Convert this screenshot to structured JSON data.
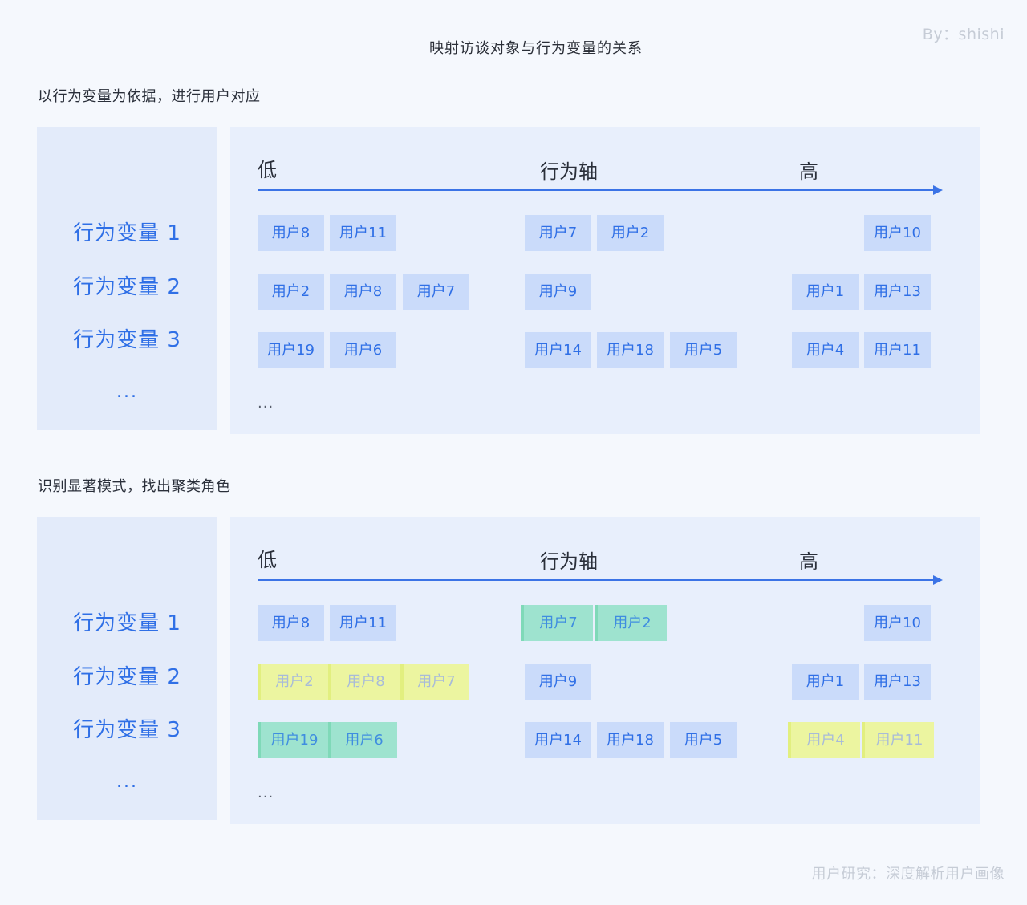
{
  "title": "映射访谈对象与行为变量的关系",
  "byline": "By：shishi",
  "footer": "用户研究：深度解析用户画像",
  "sections": [
    {
      "heading": "以行为变量为依据，进行用户对应",
      "variables": [
        "行为变量 1",
        "行为变量 2",
        "行为变量 3"
      ],
      "variables_more": "...",
      "axis": {
        "low": "低",
        "label": "行为轴",
        "high": "高"
      },
      "more": "...",
      "rows": [
        [
          {
            "label": "用户8",
            "highlight": "none"
          },
          {
            "label": "用户11",
            "highlight": "none"
          },
          {
            "label": "用户7",
            "highlight": "none"
          },
          {
            "label": "用户2",
            "highlight": "none"
          },
          {
            "label": "用户10",
            "highlight": "none"
          }
        ],
        [
          {
            "label": "用户2",
            "highlight": "none"
          },
          {
            "label": "用户8",
            "highlight": "none"
          },
          {
            "label": "用户7",
            "highlight": "none"
          },
          {
            "label": "用户9",
            "highlight": "none"
          },
          {
            "label": "用户1",
            "highlight": "none"
          },
          {
            "label": "用户13",
            "highlight": "none"
          }
        ],
        [
          {
            "label": "用户19",
            "highlight": "none"
          },
          {
            "label": "用户6",
            "highlight": "none"
          },
          {
            "label": "用户14",
            "highlight": "none"
          },
          {
            "label": "用户18",
            "highlight": "none"
          },
          {
            "label": "用户5",
            "highlight": "none"
          },
          {
            "label": "用户4",
            "highlight": "none"
          },
          {
            "label": "用户11",
            "highlight": "none"
          }
        ]
      ]
    },
    {
      "heading": "识别显著模式，找出聚类角色",
      "variables": [
        "行为变量 1",
        "行为变量 2",
        "行为变量 3"
      ],
      "variables_more": "...",
      "axis": {
        "low": "低",
        "label": "行为轴",
        "high": "高"
      },
      "more": "...",
      "rows": [
        [
          {
            "label": "用户8",
            "highlight": "none"
          },
          {
            "label": "用户11",
            "highlight": "none"
          },
          {
            "label": "用户7",
            "highlight": "green"
          },
          {
            "label": "用户2",
            "highlight": "green"
          },
          {
            "label": "用户10",
            "highlight": "none"
          }
        ],
        [
          {
            "label": "用户2",
            "highlight": "yellow"
          },
          {
            "label": "用户8",
            "highlight": "yellow"
          },
          {
            "label": "用户7",
            "highlight": "yellow"
          },
          {
            "label": "用户9",
            "highlight": "none"
          },
          {
            "label": "用户1",
            "highlight": "none"
          },
          {
            "label": "用户13",
            "highlight": "none"
          }
        ],
        [
          {
            "label": "用户19",
            "highlight": "green"
          },
          {
            "label": "用户6",
            "highlight": "green"
          },
          {
            "label": "用户14",
            "highlight": "none"
          },
          {
            "label": "用户18",
            "highlight": "none"
          },
          {
            "label": "用户5",
            "highlight": "none"
          },
          {
            "label": "用户4",
            "highlight": "yellow"
          },
          {
            "label": "用户11",
            "highlight": "yellow"
          }
        ]
      ]
    }
  ]
}
